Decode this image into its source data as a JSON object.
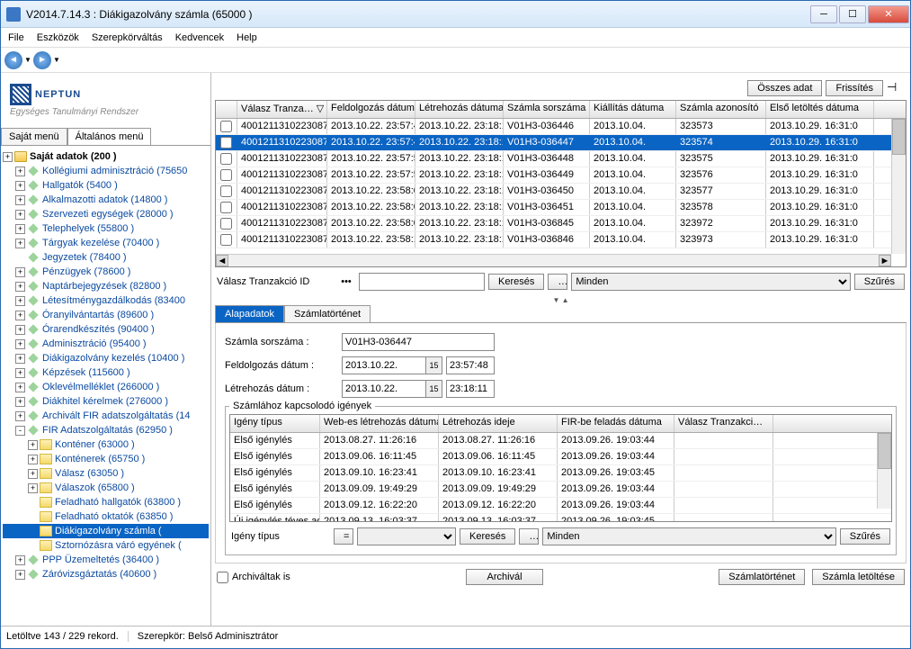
{
  "window": {
    "title": "V2014.7.14.3 : Diákigazolvány számla (65000  )"
  },
  "menubar": [
    "File",
    "Eszközök",
    "Szerepkörváltás",
    "Kedvencek",
    "Help"
  ],
  "logo": {
    "name": "NEPTUN",
    "sub": "Egységes Tanulmányi Rendszer"
  },
  "left_tabs": {
    "sajat": "Saját menü",
    "alt": "Általános menü"
  },
  "tree": [
    {
      "t": "Saját adatok (200  )",
      "exp": "+",
      "bold": true,
      "ic": "fold"
    },
    {
      "t": "Kollégiumi adminisztráció (75650",
      "exp": "+",
      "ic": "leaf",
      "ind": 1
    },
    {
      "t": "Hallgatók (5400  )",
      "exp": "+",
      "ic": "leaf",
      "ind": 1
    },
    {
      "t": "Alkalmazotti adatok (14800  )",
      "exp": "+",
      "ic": "leaf",
      "ind": 1
    },
    {
      "t": "Szervezeti egységek (28000  )",
      "exp": "+",
      "ic": "leaf",
      "ind": 1
    },
    {
      "t": "Telephelyek (55800  )",
      "exp": "+",
      "ic": "leaf",
      "ind": 1
    },
    {
      "t": "Tárgyak kezelése (70400  )",
      "exp": "+",
      "ic": "leaf",
      "ind": 1
    },
    {
      "t": "Jegyzetek (78400  )",
      "exp": "",
      "ic": "leaf",
      "ind": 1
    },
    {
      "t": "Pénzügyek (78600  )",
      "exp": "+",
      "ic": "leaf",
      "ind": 1
    },
    {
      "t": "Naptárbejegyzések (82800  )",
      "exp": "+",
      "ic": "leaf",
      "ind": 1
    },
    {
      "t": "Létesítménygazdálkodás (83400",
      "exp": "+",
      "ic": "leaf",
      "ind": 1
    },
    {
      "t": "Óranyilvántartás (89600  )",
      "exp": "+",
      "ic": "leaf",
      "ind": 1
    },
    {
      "t": "Órarendkészítés (90400  )",
      "exp": "+",
      "ic": "leaf",
      "ind": 1
    },
    {
      "t": "Adminisztráció (95400  )",
      "exp": "+",
      "ic": "leaf",
      "ind": 1
    },
    {
      "t": "Diákigazolvány kezelés (10400  )",
      "exp": "+",
      "ic": "leaf",
      "ind": 1
    },
    {
      "t": "Képzések (115600  )",
      "exp": "+",
      "ic": "leaf",
      "ind": 1
    },
    {
      "t": "Oklevélmelléklet (266000  )",
      "exp": "+",
      "ic": "leaf",
      "ind": 1
    },
    {
      "t": "Diákhitel kérelmek (276000  )",
      "exp": "+",
      "ic": "leaf",
      "ind": 1
    },
    {
      "t": "Archivált FIR adatszolgáltatás (14",
      "exp": "+",
      "ic": "leaf",
      "ind": 1
    },
    {
      "t": "FIR Adatszolgáltatás (62950  )",
      "exp": "-",
      "ic": "leaf",
      "ind": 1
    },
    {
      "t": "Konténer (63000  )",
      "exp": "+",
      "ic": "yel",
      "ind": 2
    },
    {
      "t": "Konténerek (65750  )",
      "exp": "+",
      "ic": "yel",
      "ind": 2
    },
    {
      "t": "Válasz (63050  )",
      "exp": "+",
      "ic": "yel",
      "ind": 2
    },
    {
      "t": "Válaszok (65800  )",
      "exp": "+",
      "ic": "yel",
      "ind": 2
    },
    {
      "t": "Feladható hallgatók (63800  )",
      "exp": "",
      "ic": "yel",
      "ind": 2
    },
    {
      "t": "Feladható oktatók (63850  )",
      "exp": "",
      "ic": "yel",
      "ind": 2
    },
    {
      "t": "Diákigazolvány számla (",
      "exp": "",
      "ic": "yel",
      "ind": 2,
      "sel": true
    },
    {
      "t": "Sztornózásra váró egyének (",
      "exp": "",
      "ic": "yel",
      "ind": 2
    },
    {
      "t": "PPP Üzemeltetés (36400  )",
      "exp": "+",
      "ic": "leaf",
      "ind": 1
    },
    {
      "t": "Záróvizsgáztatás (40600  )",
      "exp": "+",
      "ic": "leaf",
      "ind": 1
    }
  ],
  "top_buttons": {
    "all": "Összes adat",
    "refresh": "Frissítés"
  },
  "grid": {
    "headers": [
      "Válasz Tranza… ▽",
      "Feldolgozás dátuma",
      "Létrehozás dátuma",
      "Számla sorszáma",
      "Kiállítás dátuma",
      "Számla azonosító",
      "Első letöltés dátuma"
    ],
    "rows": [
      [
        "4001211310223087",
        "2013.10.22. 23:57:4",
        "2013.10.22. 23:18:1",
        "V01H3-036446",
        "2013.10.04.",
        "323573",
        "2013.10.29. 16:31:0"
      ],
      [
        "4001211310223087",
        "2013.10.22. 23:57:4",
        "2013.10.22. 23:18:1",
        "V01H3-036447",
        "2013.10.04.",
        "323574",
        "2013.10.29. 16:31:0"
      ],
      [
        "4001211310223087",
        "2013.10.22. 23:57:5",
        "2013.10.22. 23:18:1",
        "V01H3-036448",
        "2013.10.04.",
        "323575",
        "2013.10.29. 16:31:0"
      ],
      [
        "4001211310223087",
        "2013.10.22. 23:57:5",
        "2013.10.22. 23:18:1",
        "V01H3-036449",
        "2013.10.04.",
        "323576",
        "2013.10.29. 16:31:0"
      ],
      [
        "4001211310223087",
        "2013.10.22. 23:58:0",
        "2013.10.22. 23:18:1",
        "V01H3-036450",
        "2013.10.04.",
        "323577",
        "2013.10.29. 16:31:0"
      ],
      [
        "4001211310223087",
        "2013.10.22. 23:58:0",
        "2013.10.22. 23:18:1",
        "V01H3-036451",
        "2013.10.04.",
        "323578",
        "2013.10.29. 16:31:0"
      ],
      [
        "4001211310223087",
        "2013.10.22. 23:58:0",
        "2013.10.22. 23:18:1",
        "V01H3-036845",
        "2013.10.04.",
        "323972",
        "2013.10.29. 16:31:0"
      ],
      [
        "4001211310223087",
        "2013.10.22. 23:58:1",
        "2013.10.22. 23:18:1",
        "V01H3-036846",
        "2013.10.04.",
        "323973",
        "2013.10.29. 16:31:0"
      ]
    ],
    "selected": 1
  },
  "filter1": {
    "label": "Válasz Tranzakció ID",
    "search": "Keresés",
    "minden": "Minden",
    "szures": "Szűrés"
  },
  "detail_tabs": {
    "a": "Alapadatok",
    "b": "Számlatörténet"
  },
  "form": {
    "sorszam_lbl": "Számla sorszáma :",
    "sorszam": "V01H3-036447",
    "feld_lbl": "Feldolgozás dátum :",
    "feld_d": "2013.10.22.",
    "feld_t": "23:57:48",
    "letre_lbl": "Létrehozás dátum :",
    "letre_d": "2013.10.22.",
    "letre_t": "23:18:11"
  },
  "fieldset_legend": "Számlához kapcsolodó igények",
  "subgrid": {
    "headers": [
      "Igény típus",
      "Web-es létrehozás dátuma",
      "Létrehozás ideje",
      "FIR-be feladás dátuma",
      "Válasz Tranzakci…"
    ],
    "rows": [
      [
        "Első igénylés",
        "2013.08.27. 11:26:16",
        "2013.08.27. 11:26:16",
        "2013.09.26. 19:03:44",
        ""
      ],
      [
        "Első igénylés",
        "2013.09.06. 16:11:45",
        "2013.09.06. 16:11:45",
        "2013.09.26. 19:03:44",
        ""
      ],
      [
        "Első igénylés",
        "2013.09.10. 16:23:41",
        "2013.09.10. 16:23:41",
        "2013.09.26. 19:03:45",
        ""
      ],
      [
        "Első igénylés",
        "2013.09.09. 19:49:29",
        "2013.09.09. 19:49:29",
        "2013.09.26. 19:03:44",
        ""
      ],
      [
        "Első igénylés",
        "2013.09.12. 16:22:20",
        "2013.09.12. 16:22:20",
        "2013.09.26. 19:03:44",
        ""
      ],
      [
        "Új igénylés téves ad",
        "2013.09.13. 16:03:37",
        "2013.09.13. 16:03:37",
        "2013.09.26. 19:03:45",
        ""
      ]
    ]
  },
  "filter2": {
    "label": "Igény típus",
    "search": "Keresés",
    "minden": "Minden",
    "szures": "Szűrés"
  },
  "bottom": {
    "archivaltak": "Archiváltak is",
    "archival": "Archivál",
    "tortenet": "Számlatörténet",
    "letoltes": "Számla letöltése"
  },
  "status": {
    "records": "Letöltve 143 / 229 rekord.",
    "role": "Szerepkör: Belső Adminisztrátor"
  }
}
